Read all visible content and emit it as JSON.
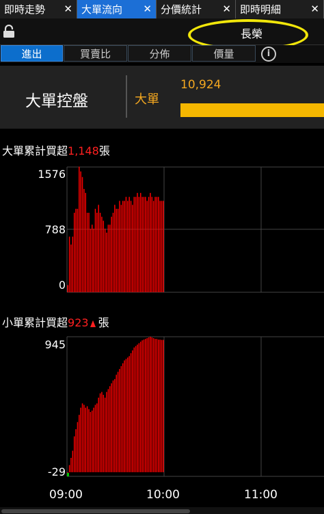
{
  "tabs": [
    {
      "label": "即時走勢",
      "close": "✕",
      "active": false
    },
    {
      "label": "大單流向",
      "close": "✕",
      "active": true
    },
    {
      "label": "分價統計",
      "close": "✕",
      "active": false
    },
    {
      "label": "即時明細",
      "close": "✕",
      "active": false
    }
  ],
  "toolbar": {
    "stock_name": "長榮",
    "lock_icon": "lock-icon"
  },
  "subtabs": [
    {
      "label": "進出",
      "active": true
    },
    {
      "label": "買賣比",
      "active": false
    },
    {
      "label": "分佈",
      "active": false
    },
    {
      "label": "價量",
      "active": false
    }
  ],
  "info_icon_glyph": "i",
  "control": {
    "title": "大單控盤",
    "label": "大單",
    "value": "10,924",
    "bar_color": "#f5b700"
  },
  "section1": {
    "prefix": "大單累計買超",
    "value": "1,148",
    "suffix": "張"
  },
  "section2": {
    "prefix": "小單累計買超",
    "value": "923",
    "suffix": "張",
    "trend": "up"
  },
  "colors": {
    "accent": "#1c6fd6",
    "bar": "#ff0000",
    "highlight": "#f1e60a",
    "value": "#f3a720"
  },
  "chart_data": [
    {
      "type": "bar",
      "title": "大單累計買超",
      "x_ticks": [
        "09:00",
        "10:00",
        "11:00"
      ],
      "y_ticks": [
        "1576",
        "788",
        "0"
      ],
      "ylim": [
        0,
        1576
      ],
      "xlim_minutes": [
        0,
        270
      ],
      "values": [
        90,
        700,
        600,
        700,
        1000,
        1050,
        1050,
        1580,
        1520,
        1450,
        1300,
        1250,
        1000,
        1000,
        800,
        850,
        800,
        1050,
        1000,
        1100,
        1000,
        950,
        900,
        800,
        750,
        850,
        850,
        950,
        1000,
        1100,
        1050,
        1050,
        1150,
        1100,
        1150,
        1150,
        1200,
        1150,
        1200,
        1150,
        1100,
        1200,
        1200,
        1250,
        1200,
        1250,
        1200,
        1200,
        1200,
        1150,
        1200,
        1250,
        1200,
        1150,
        1200,
        1200,
        1200,
        1150,
        1150,
        1150
      ]
    },
    {
      "type": "bar",
      "title": "小單累計買超",
      "x_ticks": [
        "09:00",
        "10:00",
        "11:00"
      ],
      "y_ticks": [
        "945",
        "-29"
      ],
      "ylim": [
        -29,
        945
      ],
      "xlim_minutes": [
        0,
        270
      ],
      "values": [
        0,
        50,
        100,
        150,
        250,
        300,
        350,
        400,
        450,
        480,
        470,
        450,
        460,
        440,
        420,
        430,
        450,
        470,
        480,
        520,
        550,
        560,
        540,
        520,
        560,
        580,
        600,
        620,
        640,
        650,
        680,
        700,
        720,
        740,
        760,
        780,
        790,
        800,
        810,
        830,
        850,
        870,
        880,
        890,
        900,
        910,
        920,
        925,
        930,
        935,
        940,
        945,
        940,
        935,
        930,
        930,
        925,
        925,
        923,
        923
      ]
    }
  ]
}
